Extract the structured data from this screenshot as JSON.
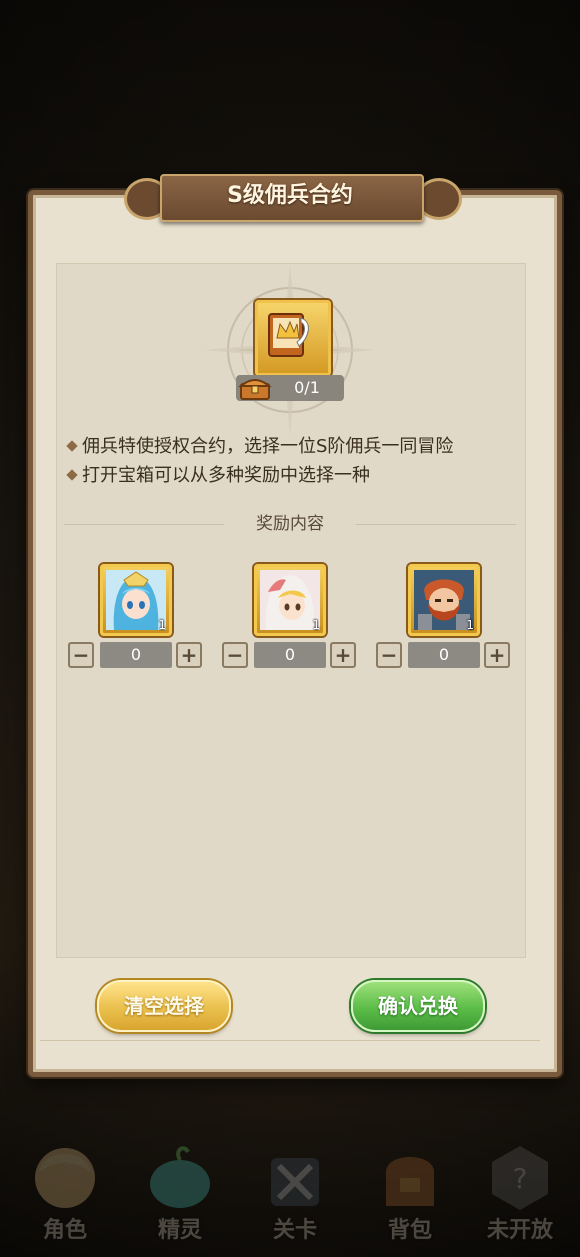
{
  "dialog": {
    "title": "S级佣兵合约",
    "count": "0/1",
    "descriptions": [
      "佣兵特使授权合约，选择一位S阶佣兵一同冒险",
      "打开宝箱可以从多种奖励中选择一种"
    ],
    "section_title": "奖励内容",
    "rewards": [
      {
        "name": "blue-haired-mercenary",
        "qty": "1",
        "value": "0"
      },
      {
        "name": "white-haired-mercenary",
        "qty": "1",
        "value": "0"
      },
      {
        "name": "bearded-warrior-mercenary",
        "qty": "1",
        "value": "0"
      }
    ],
    "stepper": {
      "minus": "−",
      "plus": "+"
    },
    "clear_button": "清空选择",
    "confirm_button": "确认兑换"
  },
  "nav": {
    "items": [
      {
        "label": "角色",
        "icon": "character-icon"
      },
      {
        "label": "精灵",
        "icon": "spirit-icon"
      },
      {
        "label": "关卡",
        "icon": "stage-icon"
      },
      {
        "label": "背包",
        "icon": "backpack-icon"
      },
      {
        "label": "未开放",
        "icon": "locked-icon"
      }
    ]
  },
  "colors": {
    "panel": "#e9e1cf",
    "title_plate": "#6b4a30",
    "clear_button": "#eac04d",
    "confirm_button": "#5cbd48",
    "item_frame": "#f3cf5d"
  }
}
